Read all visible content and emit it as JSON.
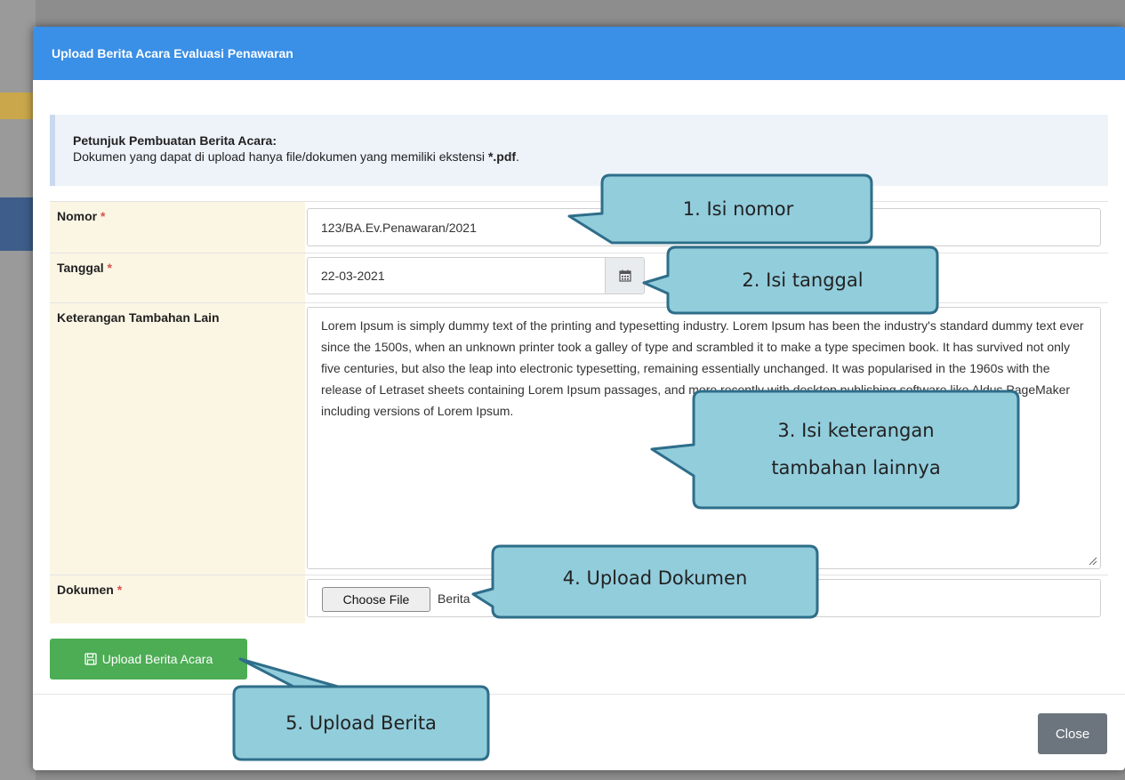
{
  "modal": {
    "title": "Upload Berita Acara Evaluasi Penawaran",
    "notice": {
      "heading": "Petunjuk Pembuatan Berita Acara:",
      "text_prefix": "Dokumen yang dapat di upload hanya file/dokumen yang memiliki ekstensi ",
      "text_ext": "*.pdf",
      "text_suffix": "."
    },
    "fields": {
      "nomor_label": "Nomor",
      "nomor_value": "123/BA.Ev.Penawaran/2021",
      "tanggal_label": "Tanggal",
      "tanggal_value": "22-03-2021",
      "keterangan_label": "Keterangan Tambahan Lain",
      "keterangan_value": "Lorem Ipsum is simply dummy text of the printing and typesetting industry. Lorem Ipsum has been the industry's standard dummy text ever since the 1500s, when an unknown printer took a galley of type and scrambled it to make a type specimen book. It has survived not only five centuries, but also the leap into electronic typesetting, remaining essentially unchanged. It was popularised in the 1960s with the release of Letraset sheets containing Lorem Ipsum passages, and more recently with desktop publishing software like Aldus PageMaker including versions of Lorem Ipsum.",
      "dokumen_label": "Dokumen",
      "choose_file_label": "Choose File",
      "file_name": "Berita",
      "required_mark": "*"
    },
    "upload_button": "Upload Berita Acara",
    "close_button": "Close"
  },
  "callouts": {
    "c1": "1. Isi nomor",
    "c2": "2. Isi tanggal",
    "c3_line1": "3. Isi keterangan",
    "c3_line2": "tambahan lainnya",
    "c4": "4. Upload Dokumen",
    "c5": "5. Upload Berita"
  },
  "colors": {
    "header": "#3a8fe6",
    "label_bg": "#fbf6e4",
    "upload_button": "#4cad54",
    "close_button": "#6c757d",
    "callout_fill": "#92cddc",
    "callout_stroke": "#2e6e8a",
    "required": "#d9534f"
  },
  "icons": {
    "calendar": "calendar-icon",
    "save": "save-icon",
    "resize": "resize-handle-icon"
  }
}
